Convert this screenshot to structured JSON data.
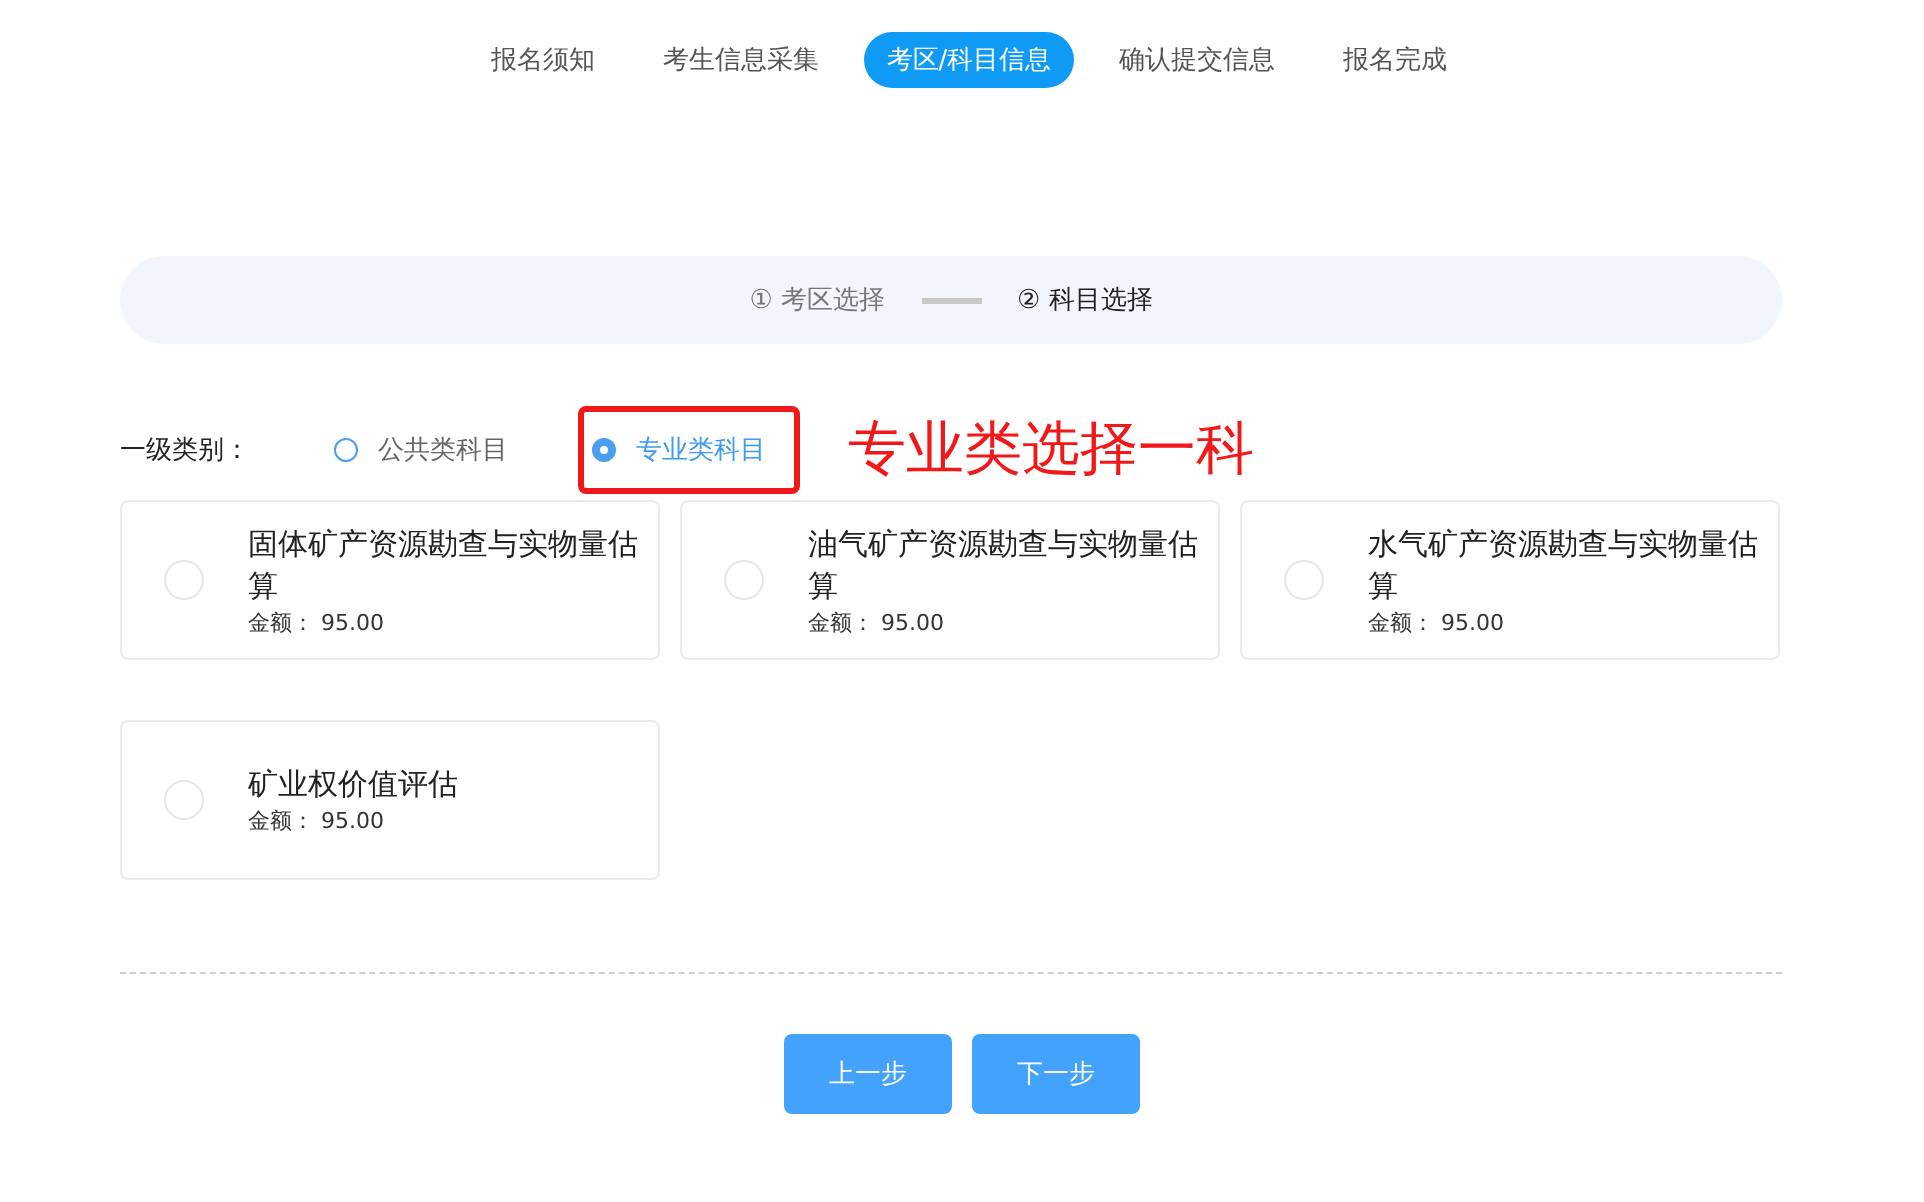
{
  "tabs": [
    {
      "label": "报名须知",
      "selected": false
    },
    {
      "label": "考生信息采集",
      "selected": false
    },
    {
      "label": "考区/科目信息",
      "selected": true
    },
    {
      "label": "确认提交信息",
      "selected": false
    },
    {
      "label": "报名完成",
      "selected": false
    }
  ],
  "steps": [
    {
      "label": "① 考区选择",
      "selected": false
    },
    {
      "label": "② 科目选择",
      "selected": true
    }
  ],
  "category": {
    "label": "一级类别：",
    "options": [
      {
        "label": "公共类科目",
        "selected": false,
        "highlighted": false
      },
      {
        "label": "专业类科目",
        "selected": true,
        "highlighted": true
      }
    ]
  },
  "annotation": "专业类选择一科",
  "subjects": [
    {
      "name": "固体矿产资源勘查与实物量估算",
      "price": "金额：  95.00",
      "selected": false
    },
    {
      "name": "油气矿产资源勘查与实物量估算",
      "price": "金额：  95.00",
      "selected": false
    },
    {
      "name": "水气矿产资源勘查与实物量估算",
      "price": "金额：  95.00",
      "selected": false
    },
    {
      "name": "矿业权价值评估",
      "price": "金额：  95.00",
      "selected": false
    }
  ],
  "buttons": [
    "上一步",
    "下一步"
  ]
}
